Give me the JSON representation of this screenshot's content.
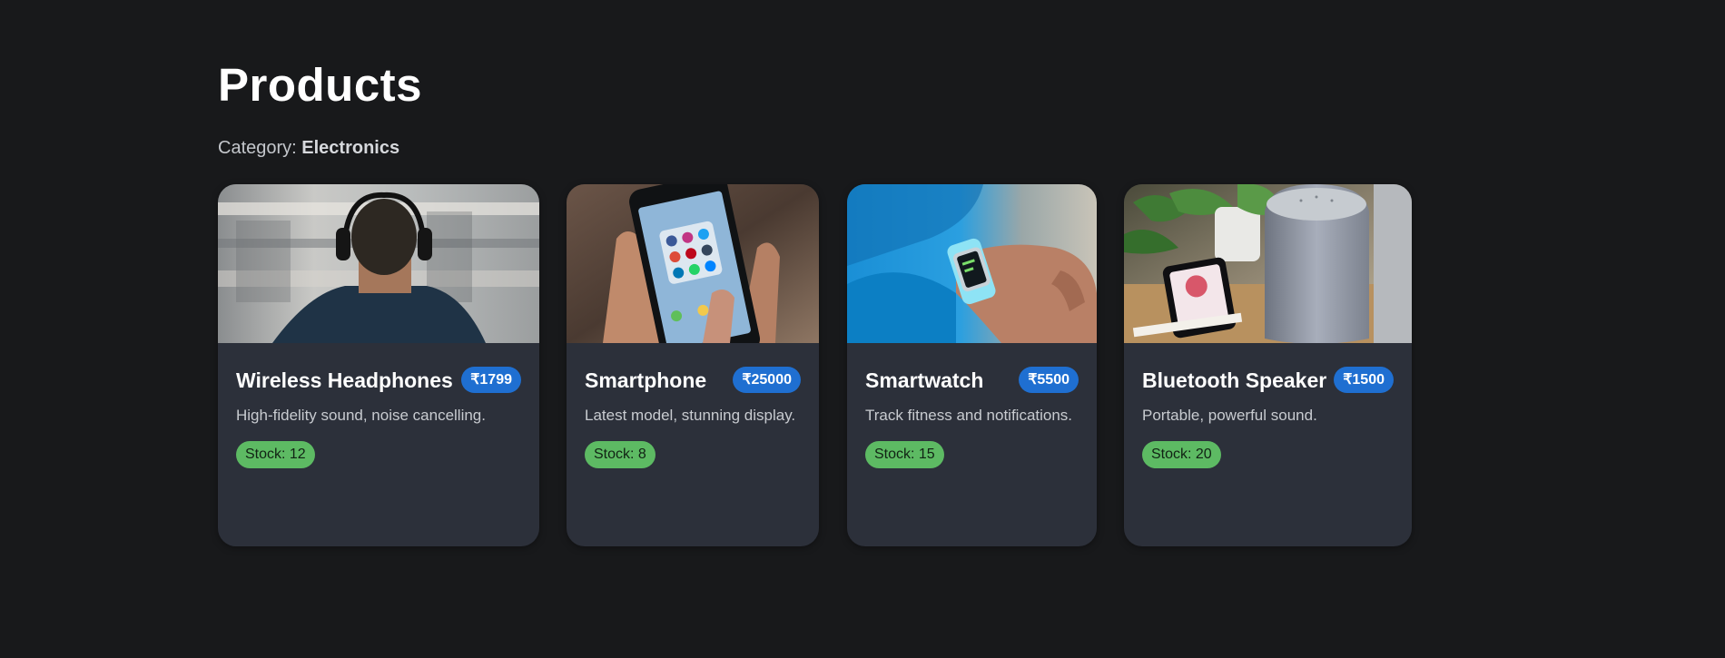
{
  "page": {
    "title": "Products",
    "category_label": "Category: ",
    "category_value": "Electronics"
  },
  "products": [
    {
      "name": "Wireless Headphones",
      "price": "₹1799",
      "description": "High-fidelity sound, noise cancelling.",
      "stock": "Stock: 12",
      "image": "headphones-photo"
    },
    {
      "name": "Smartphone",
      "price": "₹25000",
      "description": "Latest model, stunning display.",
      "stock": "Stock: 8",
      "image": "smartphone-photo"
    },
    {
      "name": "Smartwatch",
      "price": "₹5500",
      "description": "Track fitness and notifications.",
      "stock": "Stock: 15",
      "image": "smartwatch-photo"
    },
    {
      "name": "Bluetooth Speaker",
      "price": "₹1500",
      "description": "Portable, powerful sound.",
      "stock": "Stock: 20",
      "image": "speaker-photo"
    }
  ],
  "colors": {
    "background": "#18191b",
    "card": "#2c303a",
    "price_badge": "#1f6fd1",
    "stock_badge": "#5dba63"
  }
}
